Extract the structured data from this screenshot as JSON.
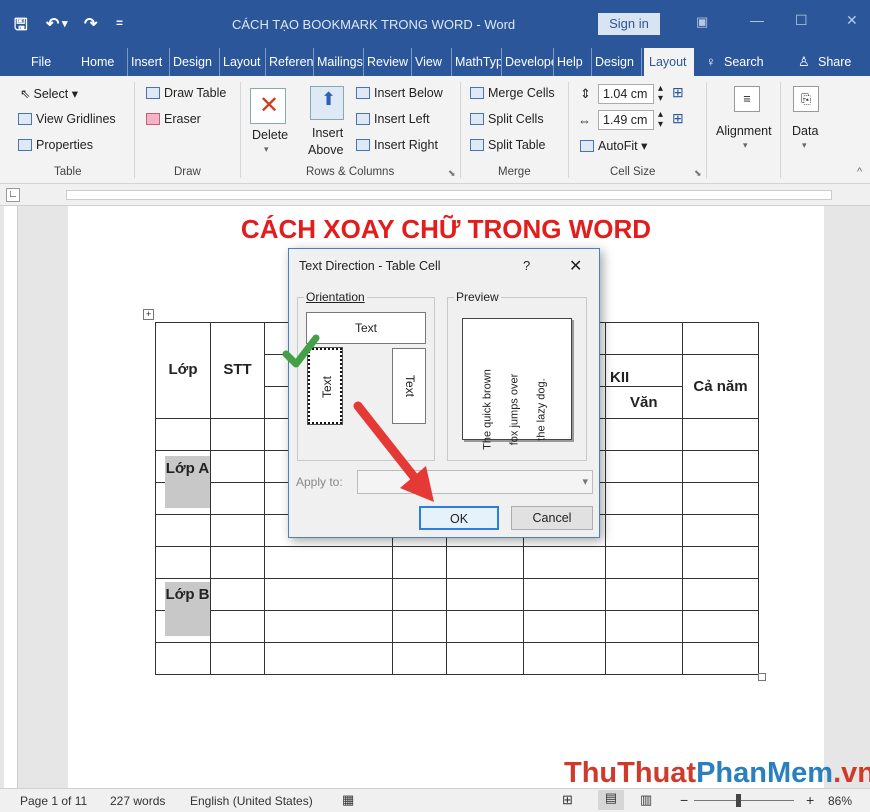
{
  "titlebar": {
    "doc_title": "CÁCH TẠO BOOKMARK TRONG WORD  -  Word",
    "sign_in": "Sign in"
  },
  "tabs": [
    {
      "label": "File"
    },
    {
      "label": "Home"
    },
    {
      "label": "Insert"
    },
    {
      "label": "Design"
    },
    {
      "label": "Layout"
    },
    {
      "label": "References"
    },
    {
      "label": "Mailings"
    },
    {
      "label": "Review"
    },
    {
      "label": "View"
    },
    {
      "label": "MathType"
    },
    {
      "label": "Developer"
    },
    {
      "label": "Help"
    },
    {
      "label": "Design"
    },
    {
      "label": "Layout"
    }
  ],
  "tab_search": "Search",
  "tab_share": "Share",
  "ribbon": {
    "table": {
      "select": "Select",
      "view_gridlines": "View Gridlines",
      "properties": "Properties",
      "label": "Table"
    },
    "draw": {
      "draw_table": "Draw Table",
      "eraser": "Eraser",
      "label": "Draw"
    },
    "rows_columns": {
      "delete": "Delete",
      "insert_above_1": "Insert",
      "insert_above_2": "Above",
      "insert_below": "Insert Below",
      "insert_left": "Insert Left",
      "insert_right": "Insert Right",
      "label": "Rows & Columns"
    },
    "merge": {
      "merge_cells": "Merge Cells",
      "split_cells": "Split Cells",
      "split_table": "Split Table",
      "label": "Merge"
    },
    "cell_size": {
      "height": "1.04 cm",
      "width": "1.49 cm",
      "autofit": "AutoFit",
      "label": "Cell Size"
    },
    "alignment": "Alignment",
    "data": "Data"
  },
  "document": {
    "title": "CÁCH XOAY CHỮ TRONG WORD",
    "table": {
      "lop": "Lớp",
      "stt": "STT",
      "hkii": "KII",
      "van": "Văn",
      "ca_nam": "Cả năm",
      "lop_a": "Lớp A",
      "lop_b": "Lớp B"
    }
  },
  "dialog": {
    "title": "Text Direction - Table Cell",
    "help": "?",
    "close": "✕",
    "orientation": "Orientation",
    "preview": "Preview",
    "opt_horizontal": "Text",
    "opt_up": "Text",
    "opt_down": "Text",
    "preview_text": [
      "The quick brown",
      "fox jumps over",
      "the lazy dog."
    ],
    "apply_to": "Apply to:",
    "ok": "OK",
    "cancel": "Cancel"
  },
  "statusbar": {
    "page": "Page 1 of 11",
    "words": "227 words",
    "language": "English (United States)",
    "zoom": "86%"
  },
  "watermark": {
    "part1": "ThuThuat",
    "part2": "PhanMem",
    "part3": ".vn"
  }
}
